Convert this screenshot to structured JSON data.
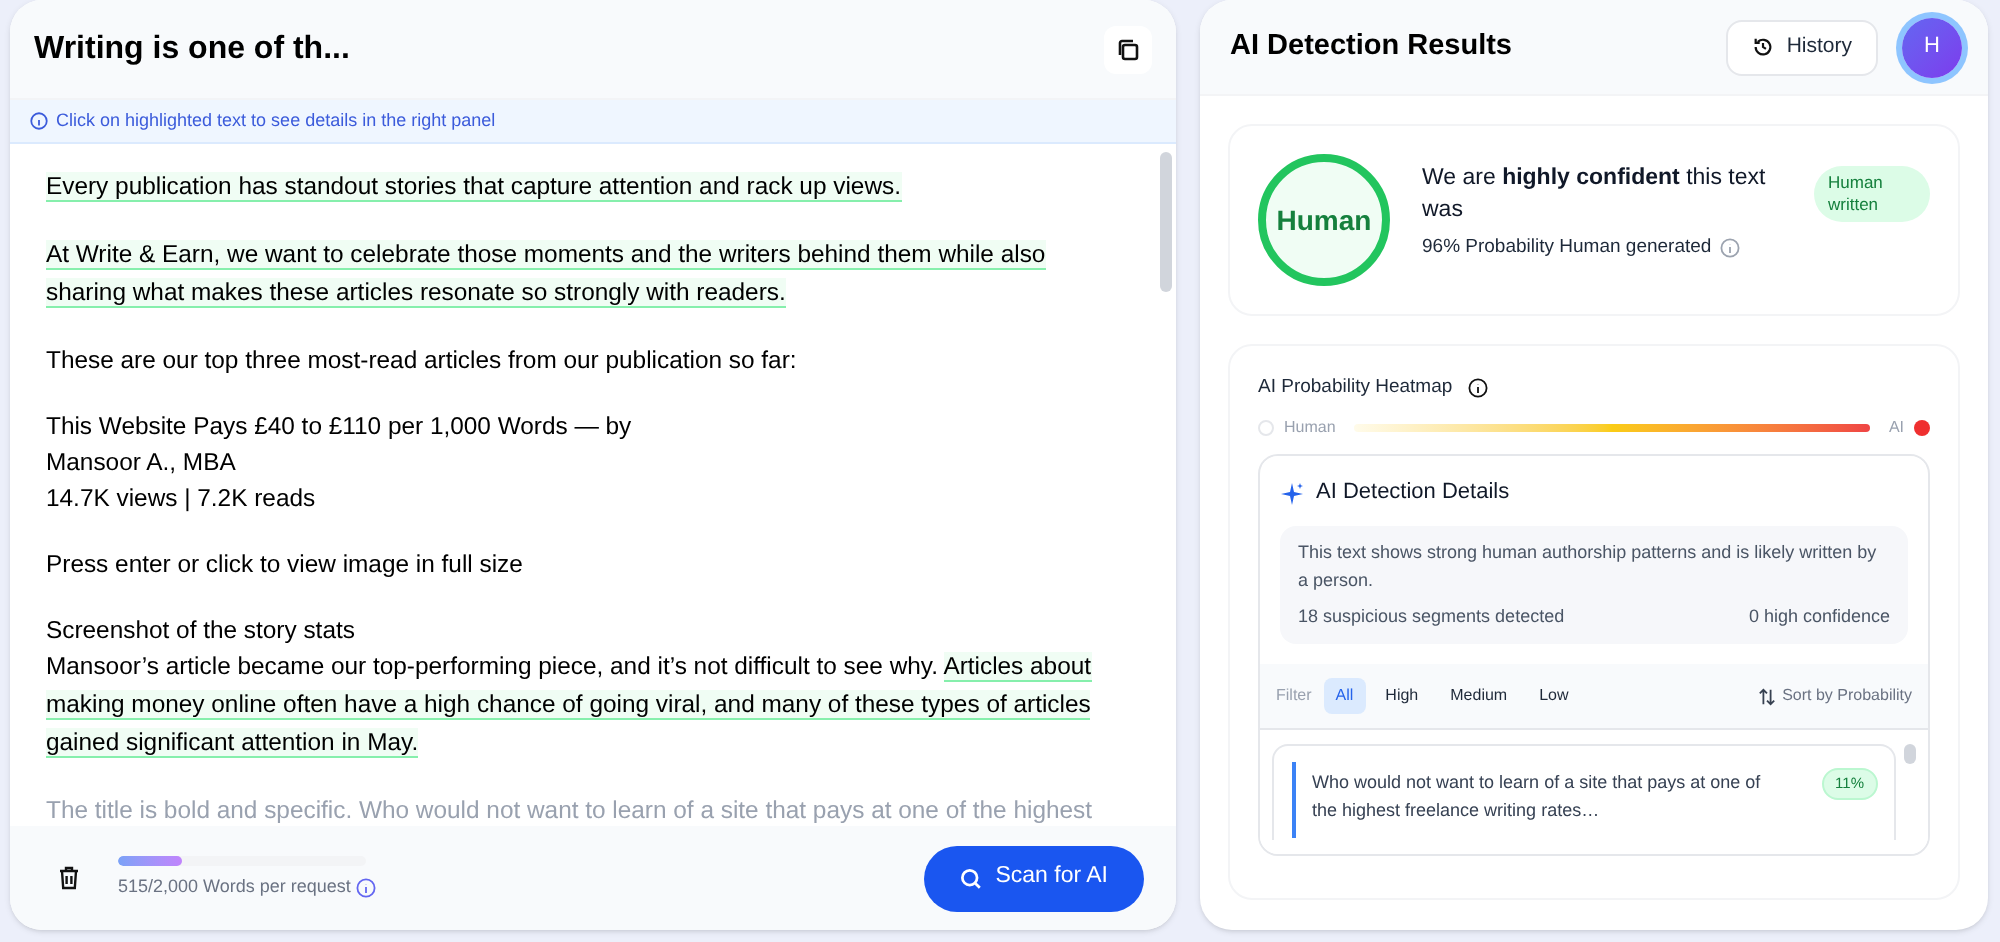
{
  "editor": {
    "title": "Writing is one of th...",
    "info": "Click on highlighted text to see details in the right panel",
    "blocks": [
      {
        "lines": [
          [
            {
              "text": "Every publication has standout stories that capture attention and rack up views.",
              "highlighted": true
            }
          ]
        ]
      },
      {
        "lines": [
          [
            {
              "text": "At Write & Earn, we want to celebrate those moments and the writers behind them while also sharing what makes these articles resonate so strongly with readers.",
              "highlighted": true
            }
          ]
        ]
      },
      {
        "lines": [
          [
            {
              "text": "These are our top three most-read articles from our publication so far:",
              "highlighted": false
            }
          ]
        ]
      },
      {
        "lines": [
          [
            {
              "text": "This Website Pays £40 to £110 per 1,000 Words — by",
              "highlighted": false
            }
          ],
          [
            {
              "text": "Mansoor A., MBA",
              "highlighted": false
            }
          ],
          [
            {
              "text": "14.7K views | 7.2K reads",
              "highlighted": false
            }
          ]
        ]
      },
      {
        "lines": [
          [
            {
              "text": "Press enter or click to view image in full size",
              "highlighted": false
            }
          ]
        ]
      },
      {
        "lines": [
          [
            {
              "text": "Screenshot of the story stats",
              "highlighted": false
            }
          ],
          [
            {
              "text": "Mansoor’s article became our top-performing piece, and it’s not difficult to see why. ",
              "highlighted": false
            },
            {
              "text": "Articles about making money online often have a high chance of going viral, and many of these types of articles gained significant attention in May.",
              "highlighted": true
            }
          ]
        ]
      },
      {
        "faded": true,
        "lines": [
          [
            {
              "text": "The title is bold and specific. Who would not want to learn of a site that pays at one of the highest",
              "highlighted": false
            }
          ]
        ]
      }
    ],
    "word_count": "515/2,000 Words per request",
    "level": 0.26,
    "scan_button": "Scan for AI"
  },
  "results": {
    "title": "AI Detection Results",
    "history_button": "History",
    "avatar": "H",
    "verdict": {
      "label": "Human",
      "headline": "We are **highly confident** this text was",
      "probability": "96% Probability Human generated",
      "badge": "Human written"
    },
    "heatmap": {
      "title": "AI Probability Heatmap",
      "left_label": "Human",
      "right_label": "AI"
    },
    "details": {
      "title": "AI Detection Details",
      "summary": "This text shows strong human authorship patterns and is likely written by a person.",
      "segments_count": "18 suspicious segments detected",
      "high_confidence": "0 high confidence"
    },
    "filter": {
      "label": "Filter",
      "options": [
        {
          "label": "All",
          "selected": true
        },
        {
          "label": "High",
          "selected": false
        },
        {
          "label": "Medium",
          "selected": false
        },
        {
          "label": "Low",
          "selected": false
        }
      ],
      "sort": "Sort by Probability"
    },
    "segments": [
      {
        "text": "Who would not want to learn of a site that pays at one of the highest freelance writing rates…",
        "score": "11%"
      }
    ]
  }
}
